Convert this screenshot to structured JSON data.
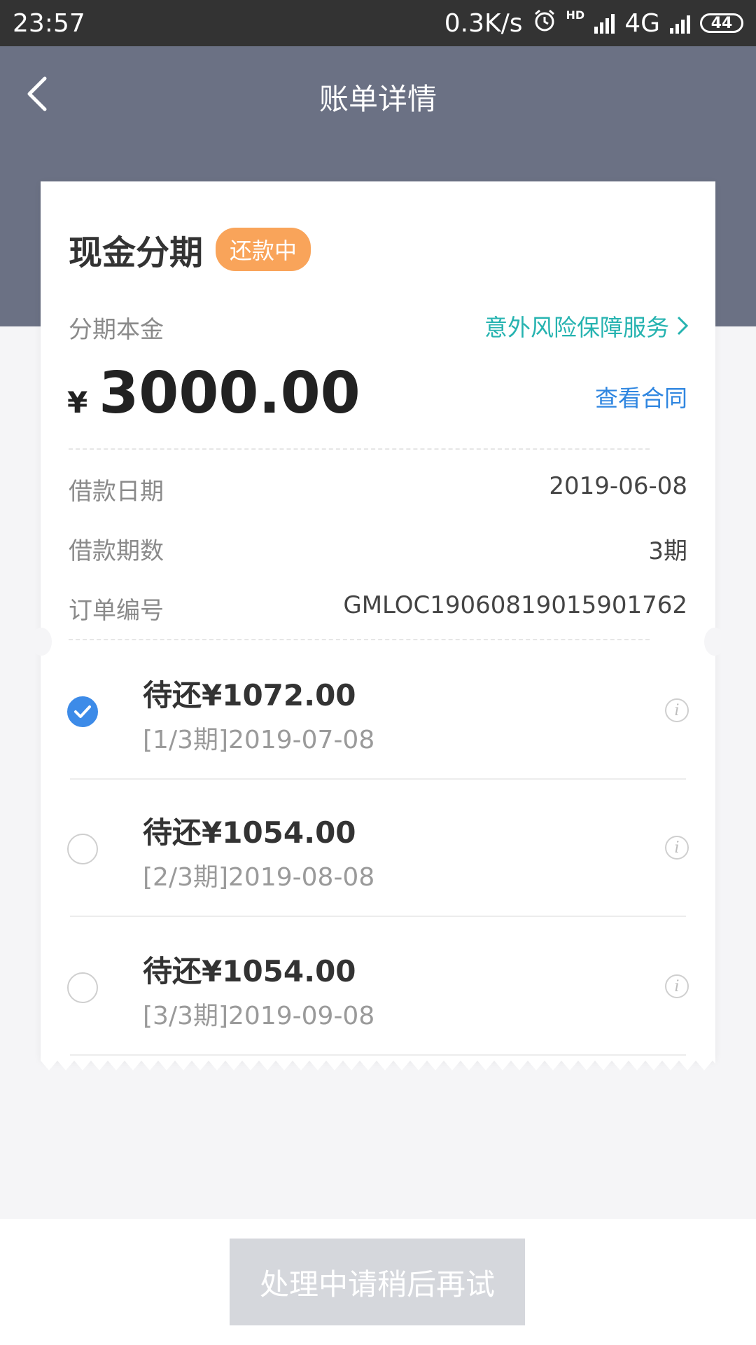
{
  "status_bar": {
    "time": "23:57",
    "net_speed": "0.3K/s",
    "hd_label": "HD",
    "network": "4G",
    "battery": "44",
    "icons": [
      "alarm-icon",
      "signal-icon",
      "signal-icon",
      "battery-icon"
    ]
  },
  "header": {
    "title": "账单详情",
    "back_icon": "chevron-left-icon"
  },
  "loan": {
    "title": "现金分期",
    "status": "还款中",
    "principal_label": "分期本金",
    "insurance_link": "意外风险保障服务",
    "currency": "¥",
    "principal_amount": "3000.00",
    "contract_link": "查看合同",
    "details": [
      {
        "label": "借款日期",
        "value": "2019-06-08"
      },
      {
        "label": "借款期数",
        "value": "3期"
      },
      {
        "label": "订单编号",
        "value": "GMLOC19060819015901762"
      }
    ]
  },
  "installments": [
    {
      "amount": "待还¥1072.00",
      "period": "[1/3期]2019-07-08",
      "selected": true
    },
    {
      "amount": "待还¥1054.00",
      "period": "[2/3期]2019-08-08",
      "selected": false
    },
    {
      "amount": "待还¥1054.00",
      "period": "[3/3期]2019-09-08",
      "selected": false
    }
  ],
  "action": {
    "label": "处理中请稍后再试"
  },
  "colors": {
    "header_bg": "#6b7184",
    "badge": "#f9a45a",
    "teal_link": "#26b3b0",
    "blue_link": "#2f86e0",
    "checked": "#3d8be8",
    "button_disabled": "#d5d7dc"
  }
}
